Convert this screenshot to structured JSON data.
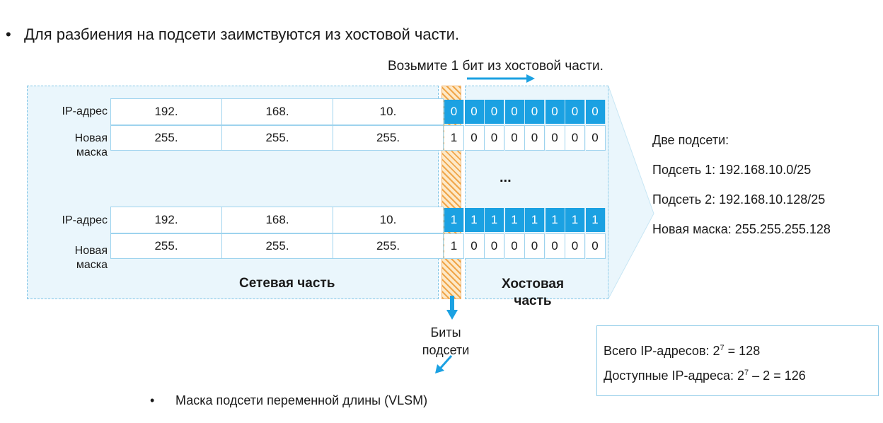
{
  "headline": "Для разбиения на подсети заимствуются из хостовой части.",
  "take_bit": "Возьмите 1 бит из хостовой части.",
  "table1": {
    "ip_label": "IP-адрес",
    "mask_label_1": "Новая",
    "mask_label_2": "маска",
    "ip_octets": [
      "192.",
      "168.",
      "10."
    ],
    "mask_octets": [
      "255.",
      "255.",
      "255."
    ],
    "ip_bits": [
      "0",
      "0",
      "0",
      "0",
      "0",
      "0",
      "0",
      "0"
    ],
    "mask_bits": [
      "1",
      "0",
      "0",
      "0",
      "0",
      "0",
      "0",
      "0"
    ]
  },
  "ellipsis": "...",
  "table2": {
    "ip_label": "IP-адрес",
    "mask_label_1": "Новая",
    "mask_label_2": "маска",
    "ip_octets": [
      "192.",
      "168.",
      "10."
    ],
    "mask_octets": [
      "255.",
      "255.",
      "255."
    ],
    "ip_bits": [
      "1",
      "1",
      "1",
      "1",
      "1",
      "1",
      "1",
      "1"
    ],
    "mask_bits": [
      "1",
      "0",
      "0",
      "0",
      "0",
      "0",
      "0",
      "0"
    ]
  },
  "network_part": "Сетевая часть",
  "host_part_1": "Хостовая",
  "host_part_2": "часть",
  "subnet_bits_1": "Биты",
  "subnet_bits_2": "подсети",
  "right_panel": {
    "title": "Две подсети:",
    "subnet1": "Подсеть 1: 192.168.10.0/25",
    "subnet2": "Подсеть 2: 192.168.10.128/25",
    "new_mask": "Новая маска: 255.255.255.128"
  },
  "info": {
    "total_prefix": "Всего IP-адресов: 2",
    "total_exp": "7",
    "total_suffix": " = 128",
    "avail_prefix": "Доступные IP-адреса: 2",
    "avail_exp": "7",
    "avail_suffix": " – 2 = 126"
  },
  "vlsm": "Маска подсети переменной длины (VLSM)",
  "colors": {
    "accent": "#1ba1e2",
    "hatch": "#f0a64a"
  }
}
